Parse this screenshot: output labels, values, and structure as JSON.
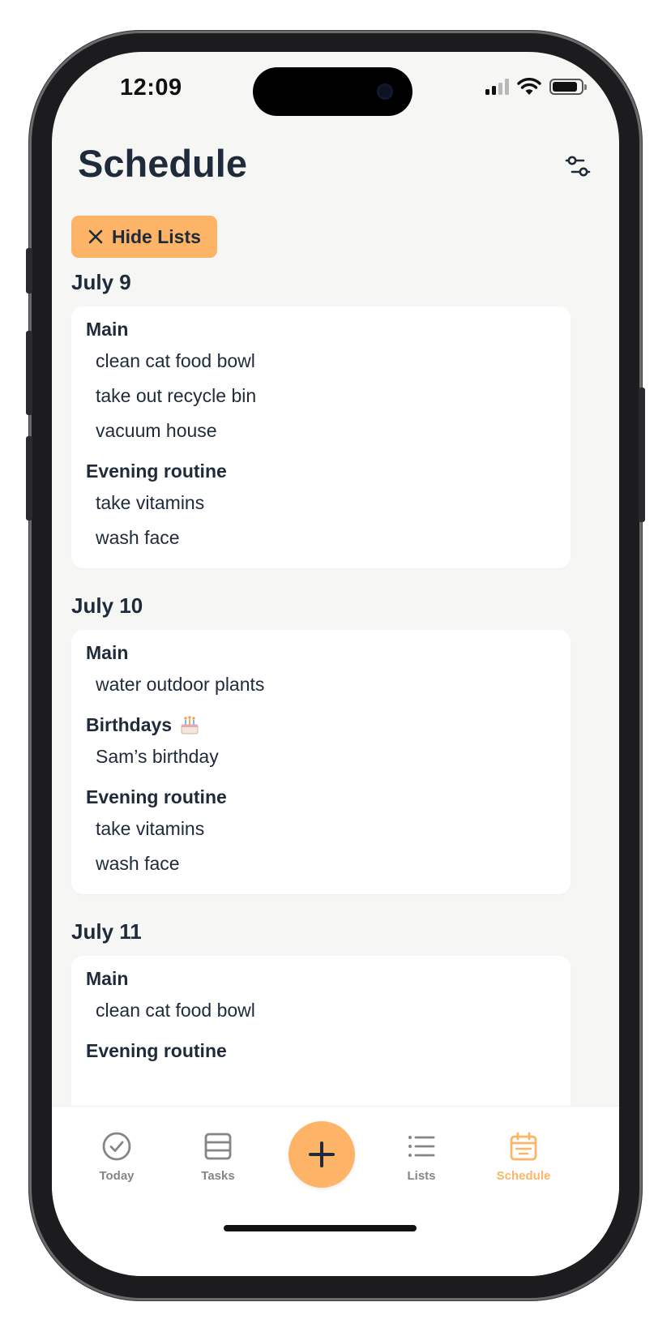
{
  "status_bar": {
    "time": "12:09"
  },
  "header": {
    "title": "Schedule"
  },
  "hide_lists_label": "Hide Lists",
  "days": [
    {
      "date": "July 9",
      "lists": [
        {
          "name": "Main",
          "tasks": [
            "clean cat food bowl",
            "take out recycle bin",
            "vacuum house"
          ]
        },
        {
          "name": "Evening routine",
          "tasks": [
            "take vitamins",
            "wash face"
          ]
        }
      ]
    },
    {
      "date": "July 10",
      "lists": [
        {
          "name": "Main",
          "tasks": [
            "water outdoor plants"
          ]
        },
        {
          "name": "Birthdays",
          "emoji": "cake-icon",
          "tasks": [
            "Sam’s birthday"
          ]
        },
        {
          "name": "Evening routine",
          "tasks": [
            "take vitamins",
            "wash face"
          ]
        }
      ]
    },
    {
      "date": "July 11",
      "lists": [
        {
          "name": "Main",
          "tasks": [
            "clean cat food bowl"
          ]
        },
        {
          "name": "Evening routine",
          "tasks": []
        }
      ]
    }
  ],
  "tab_bar": {
    "today": "Today",
    "tasks": "Tasks",
    "lists": "Lists",
    "schedule": "Schedule",
    "active": "schedule"
  },
  "colors": {
    "accent": "#fdb466",
    "text": "#1f2a3a",
    "muted": "#858585",
    "background": "#f6f6f4"
  }
}
